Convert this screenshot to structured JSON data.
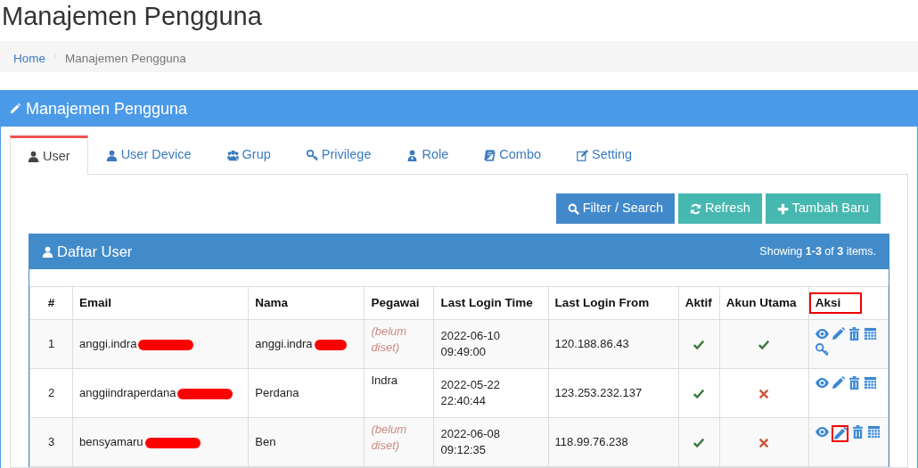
{
  "page_title": "Manajemen Pengguna",
  "breadcrumb": [
    {
      "label": "Home",
      "link": true
    },
    {
      "label": "Manajemen Pengguna",
      "link": false
    }
  ],
  "panel": {
    "title": "Manajemen Pengguna"
  },
  "tabs": [
    {
      "label": "User",
      "selected": true,
      "kind": "user"
    },
    {
      "label": "User Device",
      "selected": false,
      "kind": "user"
    },
    {
      "label": "Grup",
      "selected": false,
      "kind": "group"
    },
    {
      "label": "Privilege",
      "selected": false,
      "kind": "key"
    },
    {
      "label": "Role",
      "selected": false,
      "kind": "role"
    },
    {
      "label": "Combo",
      "selected": false,
      "kind": "book"
    },
    {
      "label": "Setting",
      "selected": false,
      "kind": "edit"
    }
  ],
  "buttons": [
    {
      "label": "Filter / Search",
      "kind": "search"
    },
    {
      "label": "Refresh",
      "kind": "refresh"
    },
    {
      "label": "Tambah Baru",
      "kind": "add"
    }
  ],
  "list": {
    "title": "Daftar User",
    "summary": "Showing **1-3** of **3** items."
  },
  "table": {
    "columns": [
      {
        "label": "#",
        "highlighted": false
      },
      {
        "label": "Email",
        "highlighted": false
      },
      {
        "label": "Nama",
        "highlighted": false
      },
      {
        "label": "Pegawai",
        "highlighted": false
      },
      {
        "label": "Last Login Time",
        "highlighted": false
      },
      {
        "label": "Last Login From",
        "highlighted": false
      },
      {
        "label": "Aktif",
        "highlighted": false
      },
      {
        "label": "Akun Utama",
        "highlighted": false
      },
      {
        "label": "Aksi",
        "highlighted": true
      }
    ],
    "rows": [
      {
        "no": "1",
        "email": "anggi.indra",
        "email_redacted": true,
        "nama": "anggi.indra",
        "nama_redacted": true,
        "pegawai": "(belum diset)",
        "pegawai_set": false,
        "last_login_time": "2022-06-10 09:49:00",
        "last_login_from": "120.188.86.43",
        "aktif": true,
        "akun_utama": true,
        "privilege_action": true,
        "edit_highlighted": false
      },
      {
        "no": "2",
        "email": "anggiindraperdana",
        "email_redacted": true,
        "nama": "Perdana",
        "nama_redacted": false,
        "pegawai": "Indra",
        "pegawai_set": true,
        "last_login_time": "2022-05-22 22:40:44",
        "last_login_from": "123.253.232.137",
        "aktif": true,
        "akun_utama": false,
        "privilege_action": false,
        "edit_highlighted": false
      },
      {
        "no": "3",
        "email": "bensyamaru",
        "email_redacted": true,
        "nama": "Ben",
        "nama_redacted": false,
        "pegawai": "(belum diset)",
        "pegawai_set": false,
        "last_login_time": "2022-06-08 09:12:35",
        "last_login_from": "118.99.76.238",
        "aktif": true,
        "akun_utama": false,
        "privilege_action": false,
        "edit_highlighted": true
      }
    ]
  }
}
